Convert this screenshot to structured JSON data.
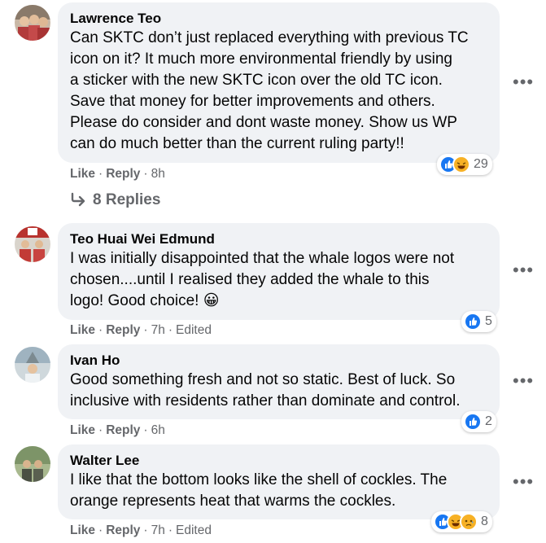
{
  "comments": [
    {
      "author": "Lawrence Teo",
      "lines": [
        "Can SKTC don’t just replaced everything with previous TC",
        "icon on it? It much more environmental friendly by using",
        "a sticker with the new SKTC icon over the old TC icon.",
        "Save that money for better improvements and others.",
        "Please do consider and dont waste money. Show us WP",
        "can do much better than the current ruling party!!"
      ],
      "like": "Like",
      "reply": "Reply",
      "time": "8h",
      "edited": "",
      "reaction_count": "29",
      "reactions": [
        "like",
        "haha"
      ]
    },
    {
      "author": "Teo Huai Wei Edmund",
      "lines": [
        "I was initially disappointed that the whale logos were not",
        "chosen....until I realised they added the whale to this",
        "logo! Good choice! 😀"
      ],
      "like": "Like",
      "reply": "Reply",
      "time": "7h",
      "edited": "Edited",
      "reaction_count": "5",
      "reactions": [
        "like"
      ]
    },
    {
      "author": "Ivan Ho",
      "lines": [
        "Good something fresh and not so static. Best of luck. So",
        "inclusive with residents rather than dominate and control."
      ],
      "like": "Like",
      "reply": "Reply",
      "time": "6h",
      "edited": "",
      "reaction_count": "2",
      "reactions": [
        "like"
      ]
    },
    {
      "author": "Walter Lee",
      "lines": [
        "I like that the bottom looks like the shell of cockles. The",
        "orange represents heat that warms the cockles."
      ],
      "like": "Like",
      "reply": "Reply",
      "time": "7h",
      "edited": "Edited",
      "reaction_count": "8",
      "reactions": [
        "like",
        "haha",
        "sad"
      ]
    }
  ],
  "replies_link": "8 Replies",
  "colors": {
    "bubble": "#f0f2f5",
    "meta": "#65676b",
    "like_blue": "#1877f2",
    "emoji_yellow": "#f7b125"
  }
}
